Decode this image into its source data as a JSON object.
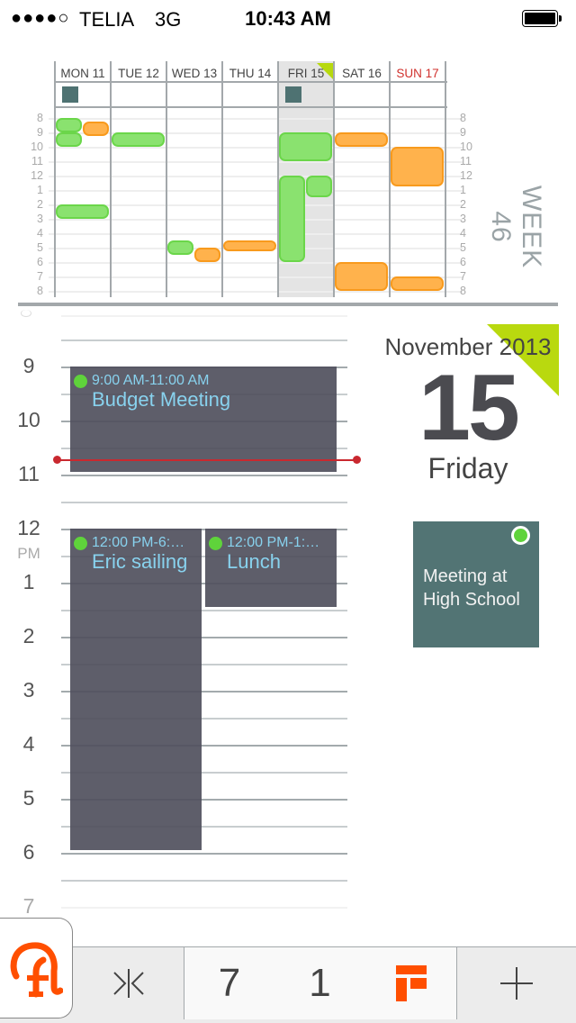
{
  "status_bar": {
    "signal": "●●●●○",
    "carrier": "TELIA",
    "network": "3G",
    "time": "10:43 AM",
    "battery_level": 1.0
  },
  "week_overview": {
    "week_label": "WEEK 46",
    "days": [
      {
        "label": "MON 11",
        "has_all_day": true
      },
      {
        "label": "TUE 12",
        "has_all_day": false
      },
      {
        "label": "WED 13",
        "has_all_day": false
      },
      {
        "label": "THU 14",
        "has_all_day": false
      },
      {
        "label": "FRI 15",
        "has_all_day": true,
        "selected": true
      },
      {
        "label": "SAT 16",
        "has_all_day": false
      },
      {
        "label": "SUN 17",
        "has_all_day": false,
        "weekend_highlight": true
      }
    ],
    "hour_labels": [
      "8",
      "9",
      "10",
      "11",
      "12",
      "1",
      "2",
      "3",
      "4",
      "5",
      "6",
      "7",
      "8"
    ],
    "events": [
      {
        "day": 0,
        "start": 8.0,
        "end": 9.0,
        "lane": 0,
        "lanes": 2,
        "color": "green"
      },
      {
        "day": 0,
        "start": 8.25,
        "end": 9.25,
        "lane": 1,
        "lanes": 2,
        "color": "orange"
      },
      {
        "day": 0,
        "start": 9.0,
        "end": 10.0,
        "lane": 0,
        "lanes": 2,
        "color": "green"
      },
      {
        "day": 0,
        "start": 14.0,
        "end": 15.0,
        "lane": 0,
        "lanes": 1,
        "color": "green"
      },
      {
        "day": 1,
        "start": 9.0,
        "end": 10.0,
        "lane": 0,
        "lanes": 1,
        "color": "green"
      },
      {
        "day": 2,
        "start": 16.5,
        "end": 17.5,
        "lane": 0,
        "lanes": 2,
        "color": "green"
      },
      {
        "day": 2,
        "start": 17.0,
        "end": 18.0,
        "lane": 1,
        "lanes": 2,
        "color": "orange"
      },
      {
        "day": 3,
        "start": 16.5,
        "end": 17.25,
        "lane": 0,
        "lanes": 1,
        "color": "orange"
      },
      {
        "day": 4,
        "start": 9.0,
        "end": 11.0,
        "lane": 0,
        "lanes": 1,
        "color": "green"
      },
      {
        "day": 4,
        "start": 12.0,
        "end": 18.0,
        "lane": 0,
        "lanes": 2,
        "color": "green"
      },
      {
        "day": 4,
        "start": 12.0,
        "end": 13.5,
        "lane": 1,
        "lanes": 2,
        "color": "green"
      },
      {
        "day": 5,
        "start": 9.0,
        "end": 10.0,
        "lane": 0,
        "lanes": 1,
        "color": "orange"
      },
      {
        "day": 5,
        "start": 18.0,
        "end": 20.0,
        "lane": 0,
        "lanes": 1,
        "color": "orange"
      },
      {
        "day": 6,
        "start": 10.0,
        "end": 12.75,
        "lane": 0,
        "lanes": 1,
        "color": "orange"
      },
      {
        "day": 6,
        "start": 19.0,
        "end": 20.0,
        "lane": 0,
        "lanes": 1,
        "color": "orange"
      }
    ]
  },
  "day_view": {
    "hours": [
      {
        "label": "9",
        "hour": 9
      },
      {
        "label": "10",
        "hour": 10
      },
      {
        "label": "11",
        "hour": 11
      },
      {
        "label": "12",
        "hour": 12,
        "suffix": "PM"
      },
      {
        "label": "1",
        "hour": 13
      },
      {
        "label": "2",
        "hour": 14
      },
      {
        "label": "3",
        "hour": 15
      },
      {
        "label": "4",
        "hour": 16
      },
      {
        "label": "5",
        "hour": 17
      },
      {
        "label": "6",
        "hour": 18
      },
      {
        "label": "7",
        "hour": 19
      }
    ],
    "current_time_hour": 10.72,
    "events": [
      {
        "time": "9:00 AM-11:00 AM",
        "title": "Budget Meeting",
        "start": 9.0,
        "end": 11.0,
        "lane": 0,
        "lanes": 1
      },
      {
        "time": "12:00 PM-6:…",
        "title": "Eric sailing",
        "start": 12.0,
        "end": 18.0,
        "lane": 0,
        "lanes": 2
      },
      {
        "time": "12:00 PM-1:…",
        "title": "Lunch",
        "start": 12.0,
        "end": 13.5,
        "lane": 1,
        "lanes": 2
      }
    ],
    "date": {
      "month_year": "November 2013",
      "day": "15",
      "weekday": "Friday"
    },
    "task": {
      "title": "Meeting at High School",
      "status": "incomplete"
    }
  },
  "tab_bar": {
    "app_icon": "app-logo-icon",
    "items": [
      {
        "name": "compress-icon",
        "label": ""
      },
      {
        "name": "week-view",
        "label": "7"
      },
      {
        "name": "day-view",
        "label": "1"
      },
      {
        "name": "agenda-view-icon",
        "label": ""
      },
      {
        "name": "add-icon",
        "label": ""
      }
    ]
  },
  "colors": {
    "accent": "#ff4f00",
    "lime_flag": "#b9d90f",
    "event_green": "#8ae26f",
    "event_orange": "#ffb24c",
    "event_dark": "#50505d",
    "event_text": "#88d2ee",
    "task_teal": "#527474",
    "now_line": "#c9282f"
  }
}
